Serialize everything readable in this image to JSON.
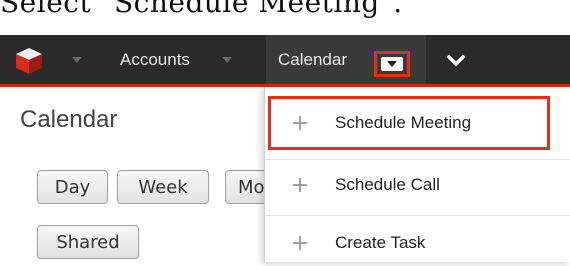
{
  "caption": "Select \"Schedule Meeting\".",
  "navbar": {
    "accounts_label": "Accounts",
    "calendar_label": "Calendar"
  },
  "page": {
    "title": "Calendar"
  },
  "view_buttons": {
    "day": "Day",
    "week": "Week",
    "month": "Mo",
    "shared": "Shared"
  },
  "dropdown": {
    "items": [
      {
        "label": "Schedule Meeting",
        "icon": "plus-icon"
      },
      {
        "label": "Schedule Call",
        "icon": "plus-icon"
      },
      {
        "label": "Create Task",
        "icon": "plus-icon"
      }
    ]
  },
  "colors": {
    "navbar_bg": "#2b2b2b",
    "accent_red": "#e2301a"
  }
}
